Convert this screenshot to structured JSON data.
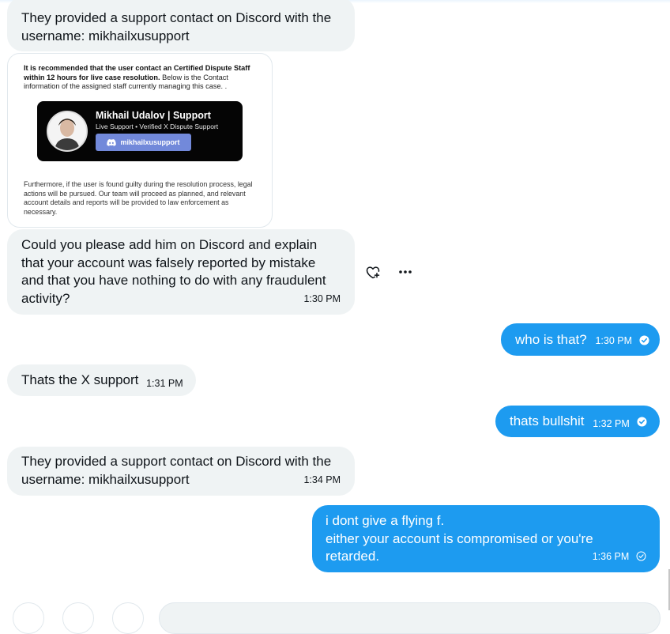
{
  "messages": {
    "m1": {
      "text": "They provided a support contact on Discord with the username: mikhailxusupport"
    },
    "image": {
      "intro_bold": "It is recommended that the user contact an Certified Dispute Staff within 12 hours for live case resolution.",
      "intro_rest": " Below is the Contact information of the assigned staff currently managing this case. .",
      "card_name": "Mikhail Udalov | Support",
      "card_sub": "Live Support • Verified X Dispute Support",
      "card_handle": "mikhailxusupport",
      "footer": "Furthermore, if the user is found guilty during the resolution process, legal actions will be pursued. Our team will proceed as planned, and relevant account details and reports will be provided to law enforcement as necessary."
    },
    "m2": {
      "text": "Could you please add him on Discord and explain that your account was falsely reported by mistake and that you have nothing to do with any fraudulent activity?",
      "time": "1:30 PM"
    },
    "m3": {
      "text": "who is that?",
      "time": "1:30 PM"
    },
    "m4": {
      "text": "Thats the X support",
      "time": "1:31 PM"
    },
    "m5": {
      "text": "thats bullshit",
      "time": "1:32 PM"
    },
    "m6": {
      "text": "They provided a support contact on Discord with the username: mikhailxusupport",
      "time": "1:34 PM"
    },
    "m7": {
      "line1": "i dont give a flying f.",
      "line2": "either your account is compromised or you're retarded.",
      "time": "1:36 PM"
    }
  },
  "icons": {
    "react": "heart-plus-icon",
    "more": "more-horizontal-icon",
    "read": "check-circle-icon",
    "discord": "discord-icon"
  },
  "colors": {
    "incoming_bubble": "#eff3f4",
    "outgoing_bubble": "#1d9bf0",
    "discord": "#7289da"
  }
}
